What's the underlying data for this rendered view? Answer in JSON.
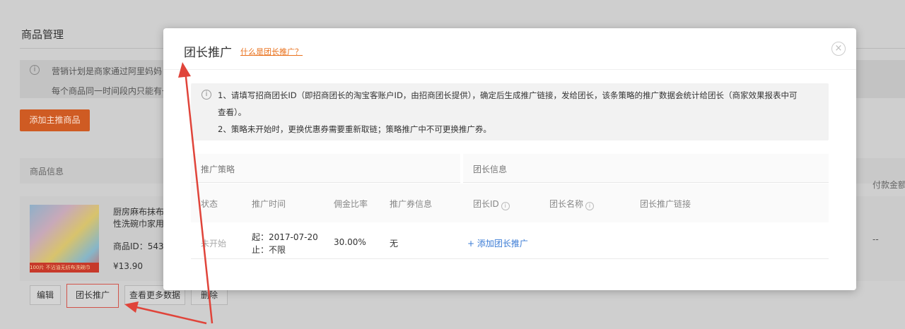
{
  "background": {
    "page_title": "商品管理",
    "notice": {
      "line1": "营销计划是商家通过阿里妈妈",
      "line2": "每个商品同一时间段内只能有一"
    },
    "add_button": "添加主推商品",
    "table_header": {
      "info": "商品信息",
      "pay": "付款金额"
    },
    "product": {
      "name_line1": "厨房麻布抹布",
      "name_line2": "性洗碗巾家用",
      "id": "商品ID：543",
      "price": "¥13.90",
      "image_tag": "不沾油无纺布洗碗巾",
      "badge": "100片",
      "pay_value": "--"
    },
    "actions": {
      "edit": "编辑",
      "leader_promo": "团长推广",
      "more_data": "查看更多数据",
      "delete": "删除"
    }
  },
  "modal": {
    "title": "团长推广",
    "help_link": "什么是团长推广？",
    "close_icon": "×",
    "notice": {
      "line1": "1、请填写招商团长ID（即招商团长的淘宝客账户ID，由招商团长提供），确定后生成推广链接，发给团长，该条策略的推广数据会统计给团长（商家效果报表中可",
      "line1b": "查看）。",
      "line2": "2、策略未开始时，更换优惠券需要重新取链；策略推广中不可更换推广券。"
    },
    "groups": {
      "strategy": "推广策略",
      "leader_info": "团长信息"
    },
    "columns": {
      "status": "状态",
      "time": "推广时间",
      "commission": "佣金比率",
      "coupon": "推广券信息",
      "leader_id": "团长ID",
      "leader_name": "团长名称",
      "leader_link": "团长推广链接"
    },
    "row": {
      "status": "未开始",
      "start": "起：2017-07-20",
      "end": "止：不限",
      "commission": "30.00%",
      "coupon": "无",
      "add_leader": "+ 添加团长推广"
    }
  },
  "colors": {
    "accent_orange": "#e9711c",
    "link_blue": "#3a7bd5",
    "arrow_red": "#e0443a"
  }
}
